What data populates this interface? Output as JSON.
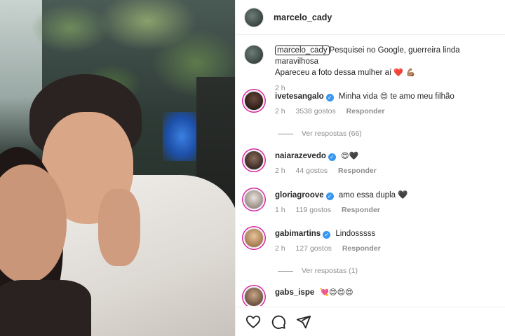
{
  "post": {
    "author": "marcelo_cady"
  },
  "caption": {
    "user": "marcelo_cady",
    "text": "Pesquisei no Google, guerreira linda maravilhosa",
    "text_line2": "Apareceu a foto dessa mulher aí",
    "emoji": "❤️ 💪🏽",
    "time": "2 h"
  },
  "comments": [
    {
      "user": "ivetesangalo",
      "verified": true,
      "text": "Minha vida",
      "emoji_mid": "😍",
      "text_after": "te amo meu filhão",
      "time": "2 h",
      "likes": "3538 gostos",
      "reply": "Responder",
      "view_replies": "Ver respostas (66)"
    },
    {
      "user": "naiarazevedo",
      "verified": true,
      "text": "😍🖤",
      "time": "2 h",
      "likes": "44 gostos",
      "reply": "Responder"
    },
    {
      "user": "gloriagroove",
      "verified": true,
      "text": "amo essa dupla 🖤",
      "time": "1 h",
      "likes": "119 gostos",
      "reply": "Responder"
    },
    {
      "user": "gabimartins",
      "verified": true,
      "text": "Lindosssss",
      "time": "2 h",
      "likes": "127 gostos",
      "reply": "Responder",
      "view_replies": "Ver respostas (1)"
    },
    {
      "user": "gabs_ispe",
      "verified": false,
      "text": "💘😍😍😍"
    }
  ],
  "icons": {
    "like": "heart-icon",
    "comment": "comment-icon",
    "share": "share-icon",
    "verified": "verified-badge-icon"
  },
  "colors": {
    "verified": "#3897f0",
    "muted": "#8e8e8e",
    "text": "#262626"
  }
}
